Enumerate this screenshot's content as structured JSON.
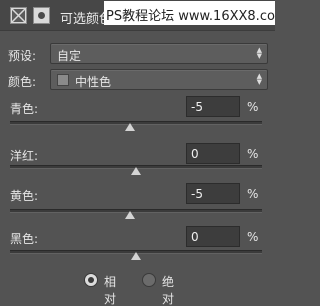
{
  "titlebar": {
    "title": "可选颜色",
    "adjustment_icon": "selective-color-adjustment-icon",
    "mask_icon": "layer-mask-icon"
  },
  "watermark": {
    "text": "PS教程论坛 www.16XX8.com"
  },
  "preset": {
    "label": "预设:",
    "value": "自定"
  },
  "colors": {
    "label": "颜色:",
    "value": "中性色",
    "swatch_color": "#8a8a8a"
  },
  "sliders": [
    {
      "label": "青色:",
      "value": "-5",
      "unit": "%",
      "level_percent": -5
    },
    {
      "label": "洋红:",
      "value": "0",
      "unit": "%",
      "level_percent": 0
    },
    {
      "label": "黄色:",
      "value": "-5",
      "unit": "%",
      "level_percent": -5
    },
    {
      "label": "黑色:",
      "value": "0",
      "unit": "%",
      "level_percent": 0
    }
  ],
  "method": {
    "options": [
      {
        "label": "相对",
        "selected": true
      },
      {
        "label": "绝对",
        "selected": false
      }
    ]
  }
}
